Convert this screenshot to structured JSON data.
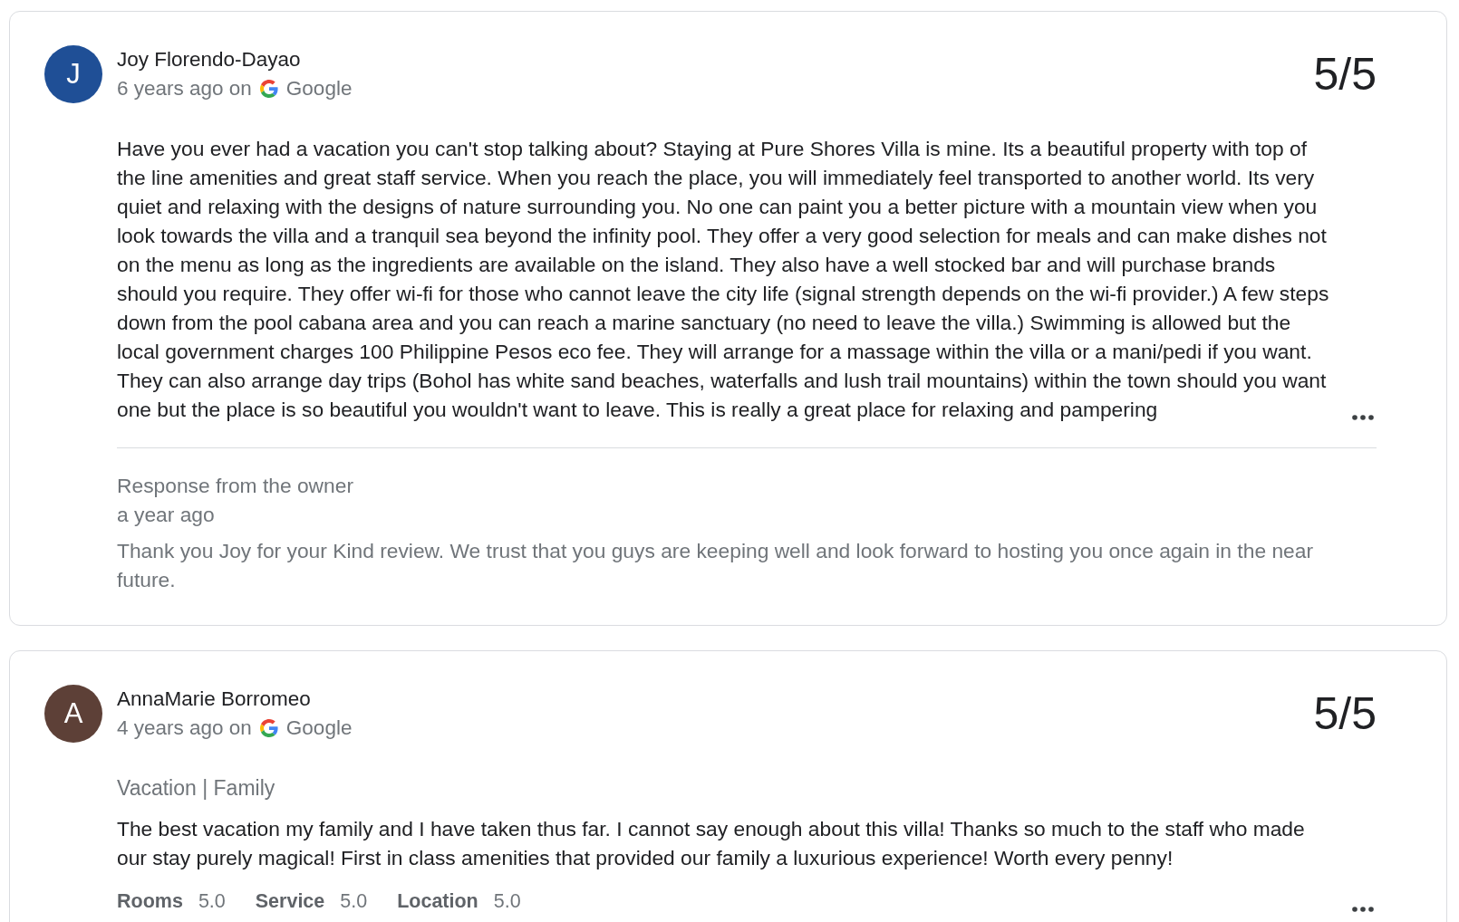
{
  "reviews": [
    {
      "initial": "J",
      "color": "#1f4f96",
      "author": "Joy Florendo-Dayao",
      "posted": "6 years ago on",
      "source": "Google",
      "score": "5/5",
      "text": "Have you ever had a vacation you can't stop talking about? Staying at Pure Shores Villa is mine. Its a beautiful property with top of the line amenities and great staff service. When you reach the place, you will immediately feel transported to another world. Its very quiet and relaxing with the designs of nature surrounding you. No one can paint you a better picture with a mountain view when you look towards the villa and a tranquil sea beyond the infinity pool. They offer a very good selection for meals and can make dishes not on the menu as long as the ingredients are available on the island. They also have a well stocked bar and will purchase brands should you require. They offer wi-fi for those who cannot leave the city life (signal strength depends on the wi-fi provider.) A few steps down from the pool cabana area and you can reach a marine sanctuary (no need to leave the villa.) Swimming is allowed but the local government charges 100 Philippine Pesos eco fee. They will arrange for a massage within the villa or a mani/pedi if you want. They can also arrange day trips (Bohol has white sand beaches, waterfalls and lush trail mountains) within the town should you want one but the place is so beautiful you wouldn't want to leave. This is really a great place for relaxing and pampering",
      "owner_response": {
        "label": "Response from the owner",
        "time": "a year ago",
        "text": "Thank you Joy for your Kind review. We trust that you guys are keeping well and look forward to hosting you once again in the near future."
      }
    },
    {
      "initial": "A",
      "color": "#5d4037",
      "author": "AnnaMarie Borromeo",
      "posted": "4 years ago on",
      "source": "Google",
      "score": "5/5",
      "trip_type": "Vacation | Family",
      "text": "The best vacation my family and I have taken thus far. I cannot say enough about this villa! Thanks so much to the staff who made our stay purely magical! First in class amenities that provided our family a luxurious experience! Worth every penny!",
      "ratings": [
        {
          "label": "Rooms",
          "value": "5.0"
        },
        {
          "label": "Service",
          "value": "5.0"
        },
        {
          "label": "Location",
          "value": "5.0"
        }
      ]
    }
  ]
}
